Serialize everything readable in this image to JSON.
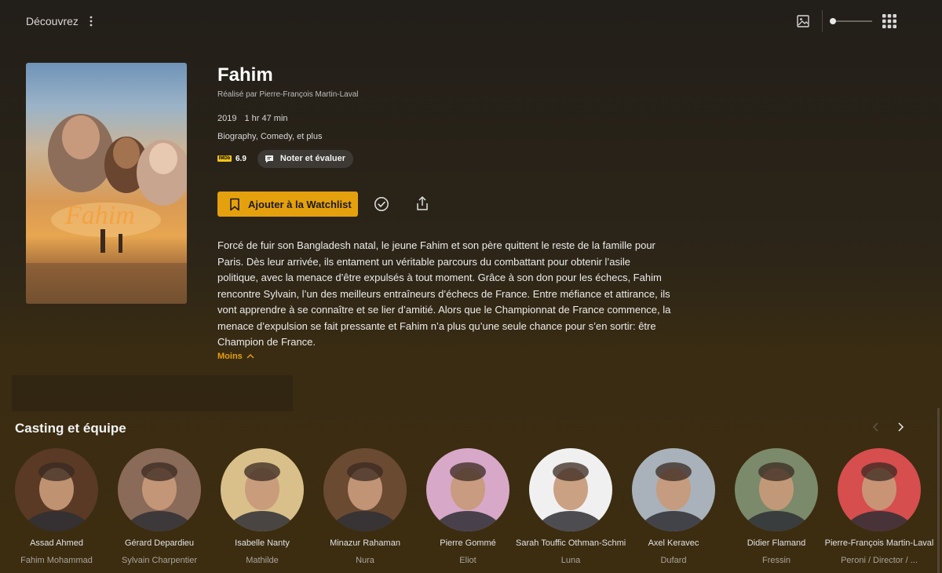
{
  "topbar": {
    "nav_title": "Découvrez",
    "icons": {
      "more": "more-vertical-icon",
      "poster_view": "image-icon",
      "size_slider": "size-slider",
      "grid_view": "grid-icon"
    }
  },
  "movie": {
    "title": "Fahim",
    "director_line": "Réalisé par Pierre-François Martin-Laval",
    "year": "2019",
    "duration": "1 hr 47 min",
    "genres": "Biography, Comedy, et plus",
    "imdb_label": "IMDb",
    "imdb_score": "6.9",
    "rate_label": "Noter et évaluer",
    "poster_title": "Fahim",
    "summary": "Forcé de fuir son Bangladesh natal, le jeune Fahim et son père quittent le reste de la famille pour Paris. Dès leur arrivée, ils entament un véritable parcours du combattant pour obtenir l’asile politique, avec la menace d’être expulsés à tout moment. Grâce à son don pour les échecs, Fahim rencontre Sylvain, l’un des meilleurs entraîneurs d’échecs de France. Entre méfiance et attirance, ils vont apprendre à se connaître et se lier d’amitié. Alors que le Championnat de France commence, la menace d’expulsion se fait pressante et Fahim n’a plus qu’une seule chance pour s’en sortir: être Champion de France.",
    "less_label": "Moins"
  },
  "actions": {
    "watchlist_label": "Ajouter à la Watchlist",
    "watched_icon": "check-circle-icon",
    "share_icon": "share-icon"
  },
  "colors": {
    "accent": "#e5a00d",
    "imdb": "#f5c518"
  },
  "cast": {
    "title": "Casting et équipe",
    "members": [
      {
        "name": "Assad Ahmed",
        "role": "Fahim Mohammad",
        "tone": "#5a3a24"
      },
      {
        "name": "Gérard Depardieu",
        "role": "Sylvain Charpentier",
        "tone": "#8a6a58"
      },
      {
        "name": "Isabelle Nanty",
        "role": "Mathilde",
        "tone": "#d9c08a"
      },
      {
        "name": "Minazur Rahaman",
        "role": "Nura",
        "tone": "#6b4a32"
      },
      {
        "name": "Pierre Gommé",
        "role": "Eliot",
        "tone": "#d8a8c8"
      },
      {
        "name": "Sarah Touffic Othman-Schmitt",
        "role": "Luna",
        "tone": "#f0f0f0"
      },
      {
        "name": "Axel Keravec",
        "role": "Dufard",
        "tone": "#a9b2ba"
      },
      {
        "name": "Didier Flamand",
        "role": "Fressin",
        "tone": "#7b8a6a"
      },
      {
        "name": "Pierre-François Martin-Laval",
        "role": "Peroni / Director / ...",
        "tone": "#d64e4e"
      }
    ]
  }
}
